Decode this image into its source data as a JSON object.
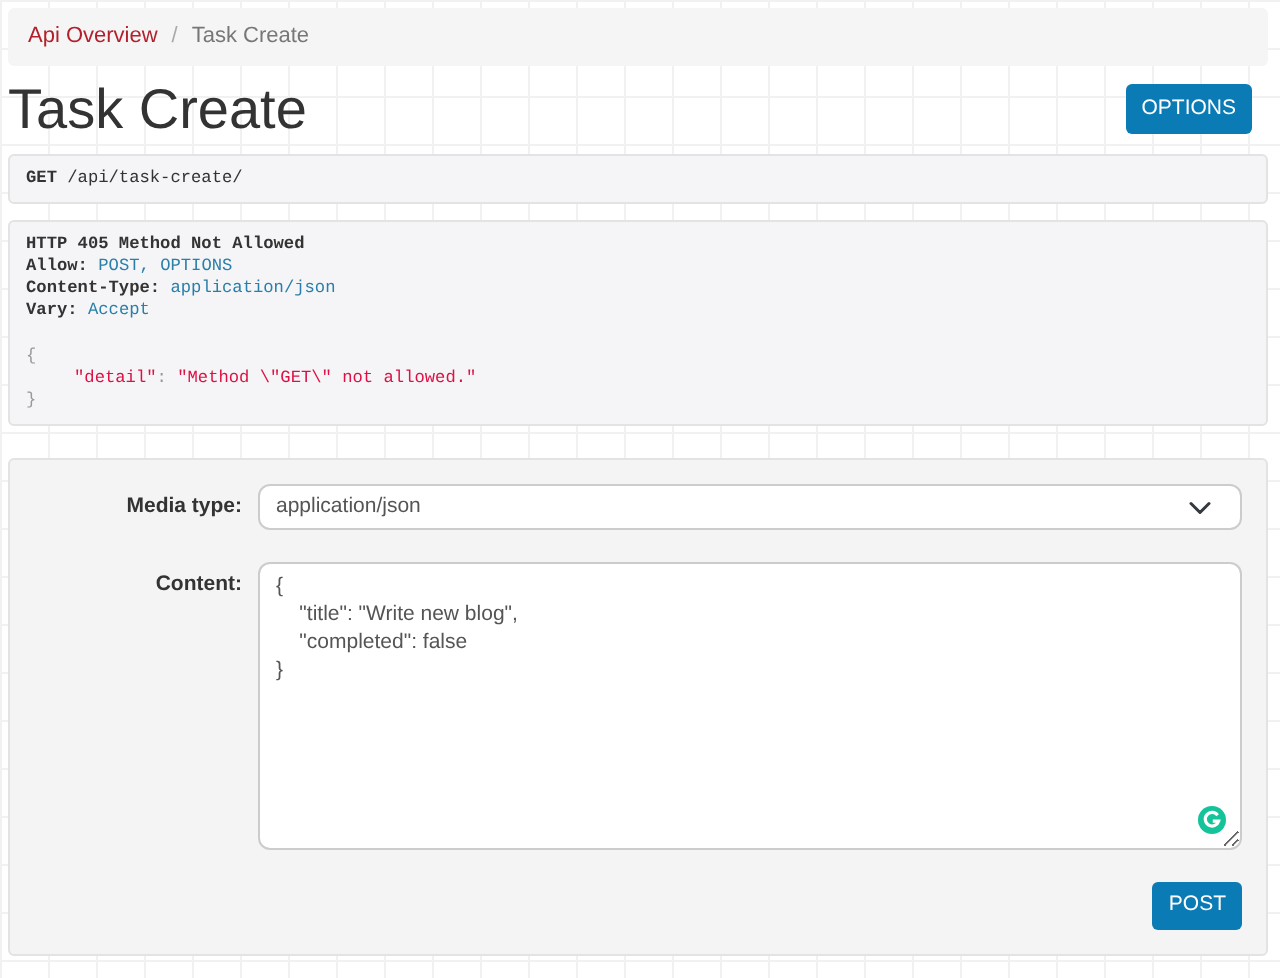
{
  "breadcrumb_separator": "/",
  "breadcrumb": [
    {
      "label": "Api Overview",
      "active": false
    },
    {
      "label": "Task Create",
      "active": true
    }
  ],
  "title": "Task Create",
  "options_button": "OPTIONS",
  "request": "**GET** /api/task-create/",
  "response": {
    "status": "HTTP 405 Method Not Allowed",
    "headers": [
      {
        "name": "Allow:",
        "value": "POST, OPTIONS"
      },
      {
        "name": "Content-Type:",
        "value": "application/json"
      },
      {
        "name": "Vary:",
        "value": "Accept"
      }
    ],
    "body": [
      {
        "kind": "punct",
        "text": "{"
      },
      {
        "kind": "pair",
        "key": "\"detail\"",
        "separator": ":",
        "value": "\"Method \\\"GET\\\" not allowed.\""
      },
      {
        "kind": "punct",
        "text": "}"
      }
    ]
  },
  "form": {
    "media_type_label": "Media type:",
    "media_type": "application/json",
    "content_label": "Content:",
    "content": "{\n    \"title\": \"Write new blog\",\n    \"completed\": false\n}",
    "submit": "POST"
  }
}
